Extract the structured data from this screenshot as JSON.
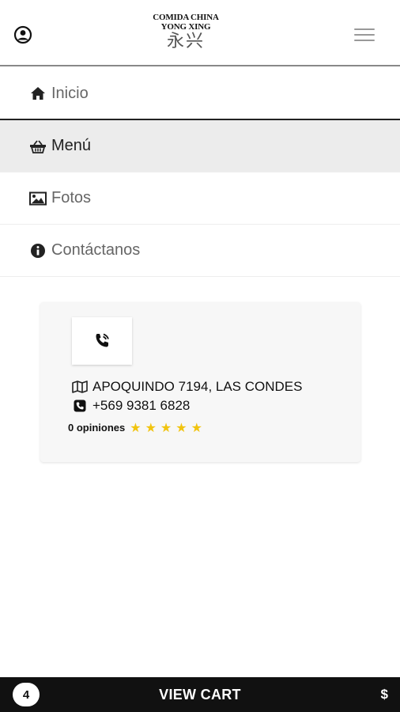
{
  "header": {
    "logo_line1": "COMIDA CHINA",
    "logo_line2": "YONG XING",
    "logo_mark": "永兴",
    "user_icon": "user-circle-icon",
    "menu_icon": "hamburger-menu-icon"
  },
  "nav": {
    "items": [
      {
        "label": "Inicio",
        "icon": "home-icon"
      },
      {
        "label": "Menú",
        "icon": "basket-icon",
        "active": true
      },
      {
        "label": "Fotos",
        "icon": "image-icon"
      },
      {
        "label": "Contáctanos",
        "icon": "info-icon"
      }
    ]
  },
  "card": {
    "call_icon": "phone-ringing-icon",
    "address": "APOQUINDO 7194, LAS CONDES",
    "phone": "+569 9381 6828",
    "reviews_label": "0 opiniones",
    "star_glyph": "★",
    "stars": 5
  },
  "cart": {
    "count": "4",
    "label": "VIEW CART",
    "currency": "$"
  },
  "colors": {
    "star": "#f1c40f",
    "cart_bar": "#111111",
    "active_nav": "#ececec"
  }
}
